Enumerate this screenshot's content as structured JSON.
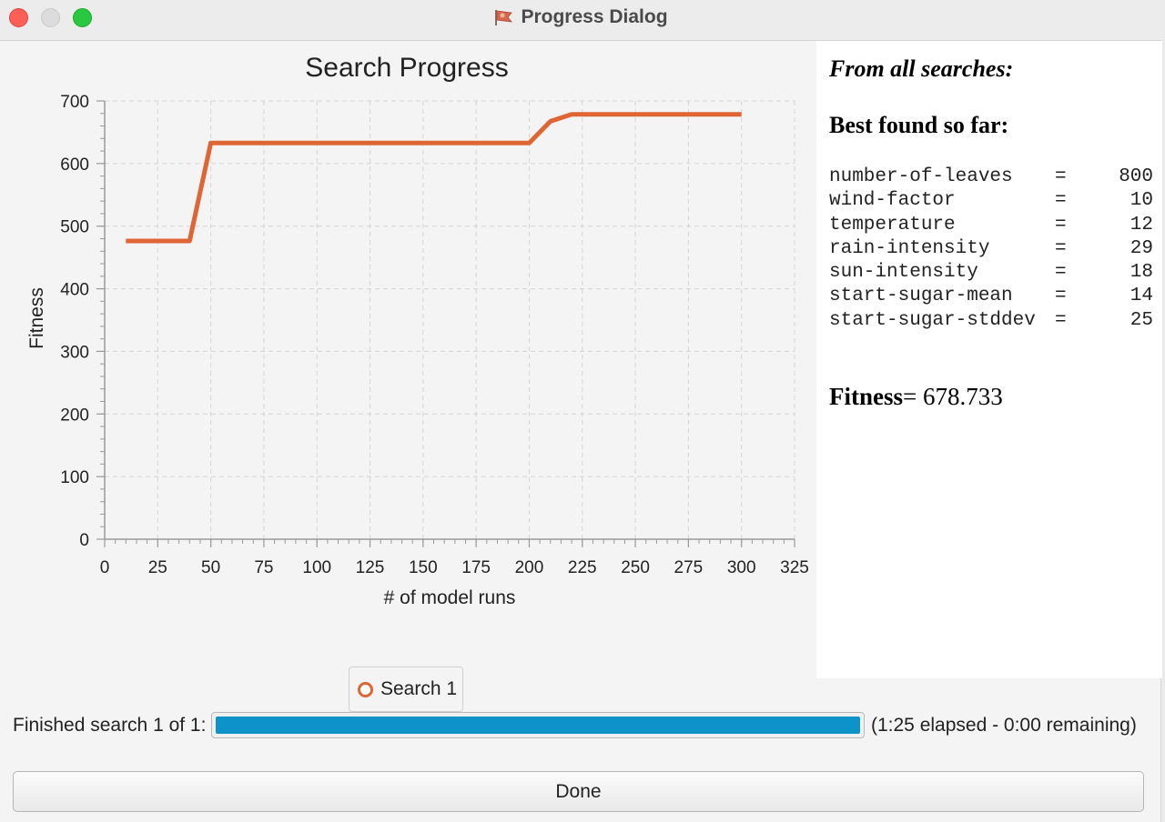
{
  "window": {
    "title": "Progress Dialog",
    "app_icon": "netlogo-flag-icon"
  },
  "chart_data": {
    "type": "line",
    "title": "Search Progress",
    "xlabel": "# of model runs",
    "ylabel": "Fitness",
    "xlim": [
      0,
      325
    ],
    "ylim": [
      0,
      700
    ],
    "x_ticks": [
      0,
      25,
      50,
      75,
      100,
      125,
      150,
      175,
      200,
      225,
      250,
      275,
      300,
      325
    ],
    "y_ticks": [
      0,
      100,
      200,
      300,
      400,
      500,
      600,
      700
    ],
    "grid": true,
    "legend_position": "bottom-center",
    "series": [
      {
        "name": "Search 1",
        "color": "#e06535",
        "points": [
          [
            10,
            476.4
          ],
          [
            40,
            476.4
          ],
          [
            50,
            632.9
          ],
          [
            200,
            632.9
          ],
          [
            210,
            667.4
          ],
          [
            220,
            678.7
          ],
          [
            300,
            678.7
          ]
        ]
      }
    ]
  },
  "info": {
    "heading_all": "From all searches:",
    "heading_best": "Best found so far:",
    "params": [
      {
        "name": "number-of-leaves",
        "eq": "=",
        "value": "800"
      },
      {
        "name": "wind-factor",
        "eq": "=",
        "value": "10"
      },
      {
        "name": "temperature",
        "eq": "=",
        "value": "12"
      },
      {
        "name": "rain-intensity",
        "eq": "=",
        "value": "29"
      },
      {
        "name": "sun-intensity",
        "eq": "=",
        "value": "18"
      },
      {
        "name": "start-sugar-mean",
        "eq": "=",
        "value": "14"
      },
      {
        "name": "start-sugar-stddev",
        "eq": "=",
        "value": "25"
      }
    ],
    "fitness_label": "Fitness",
    "fitness_value": "= 678.733"
  },
  "status": {
    "label": "Finished search 1 of 1:",
    "progress": 1.0,
    "elapsed": "(1:25 elapsed - 0:00 remaining)"
  },
  "done_button": "Done",
  "colors": {
    "series": "#e06535",
    "progress": "#0d93c9",
    "close": "#fe5f57",
    "maximize": "#29c840"
  }
}
